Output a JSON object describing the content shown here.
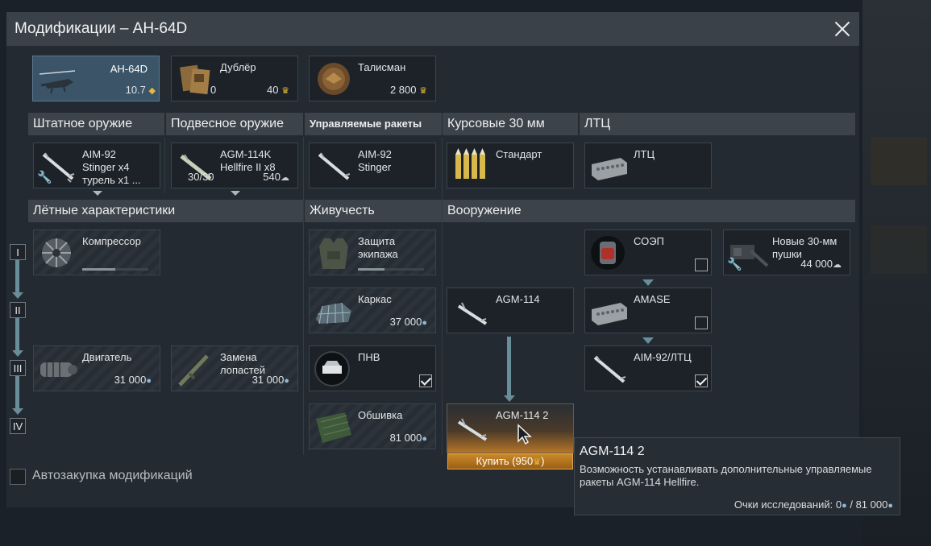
{
  "window": {
    "title": "Модификации – AH-64D"
  },
  "top": {
    "vehicle": {
      "name": "AH-64D",
      "br": "10.7"
    },
    "crew": {
      "name": "Дублёр",
      "count": "0",
      "cost": "40"
    },
    "talisman": {
      "name": "Талисман",
      "cost": "2 800"
    }
  },
  "weapon_headers": [
    "Штатное оружие",
    "Подвесное оружие",
    "Управляемые ракеты",
    "Курсовые 30 мм",
    "ЛТЦ"
  ],
  "weapons": {
    "standard": {
      "name": "AIM-92\nStinger x4\nтурель x1 ..."
    },
    "suspended": {
      "name": "AGM-114K\nHellfire II x8",
      "count": "30/30",
      "cost": "540"
    },
    "guided": {
      "name": "AIM-92\nStinger"
    },
    "gun": {
      "name": "Стандарт"
    },
    "ltc": {
      "name": "ЛТЦ"
    }
  },
  "mod_headers": [
    "Лётные характеристики",
    "Живучесть",
    "Вооружение"
  ],
  "tiers": [
    "I",
    "II",
    "III",
    "IV"
  ],
  "mods": {
    "compressor": {
      "name": "Компрессор",
      "progress": 0.5
    },
    "engine": {
      "name": "Двигатель",
      "cost": "31 000"
    },
    "blades": {
      "name": "Замена\nлопастей",
      "cost": "31 000"
    },
    "crew_protect": {
      "name": "Защита\nэкипажа",
      "progress": 0.4
    },
    "frame": {
      "name": "Каркас",
      "cost": "37 000"
    },
    "pnv": {
      "name": "ПНВ",
      "checked": true
    },
    "skin": {
      "name": "Обшивка",
      "cost": "81 000"
    },
    "agm114": {
      "name": "AGM-114"
    },
    "agm114_2": {
      "name": "AGM-114 2"
    },
    "soep": {
      "name": "СОЭП",
      "checked": false
    },
    "amase": {
      "name": "AMASE",
      "checked": false
    },
    "aim92": {
      "name": "AIM-92/ЛТЦ",
      "checked": true
    },
    "new_guns": {
      "name": "Новые 30-мм\nпушки",
      "cost": "44 000"
    }
  },
  "buy": {
    "label": "Купить (950",
    "suffix": ")"
  },
  "tooltip": {
    "title": "AGM-114 2",
    "desc": "Возможность устанавливать дополнительные управляемые ракеты AGM-114 Hellfire.",
    "rp_label": "Очки исследований: ",
    "rp_have": "0",
    "rp_sep": " / ",
    "rp_need": "81 000"
  },
  "auto_buy": {
    "label": "Автозакупка модификаций",
    "checked": false
  },
  "colors": {
    "accent": "#3b5468",
    "buy": "#b5761f",
    "research": "#8fb7d8",
    "gold": "#e7b83e"
  }
}
